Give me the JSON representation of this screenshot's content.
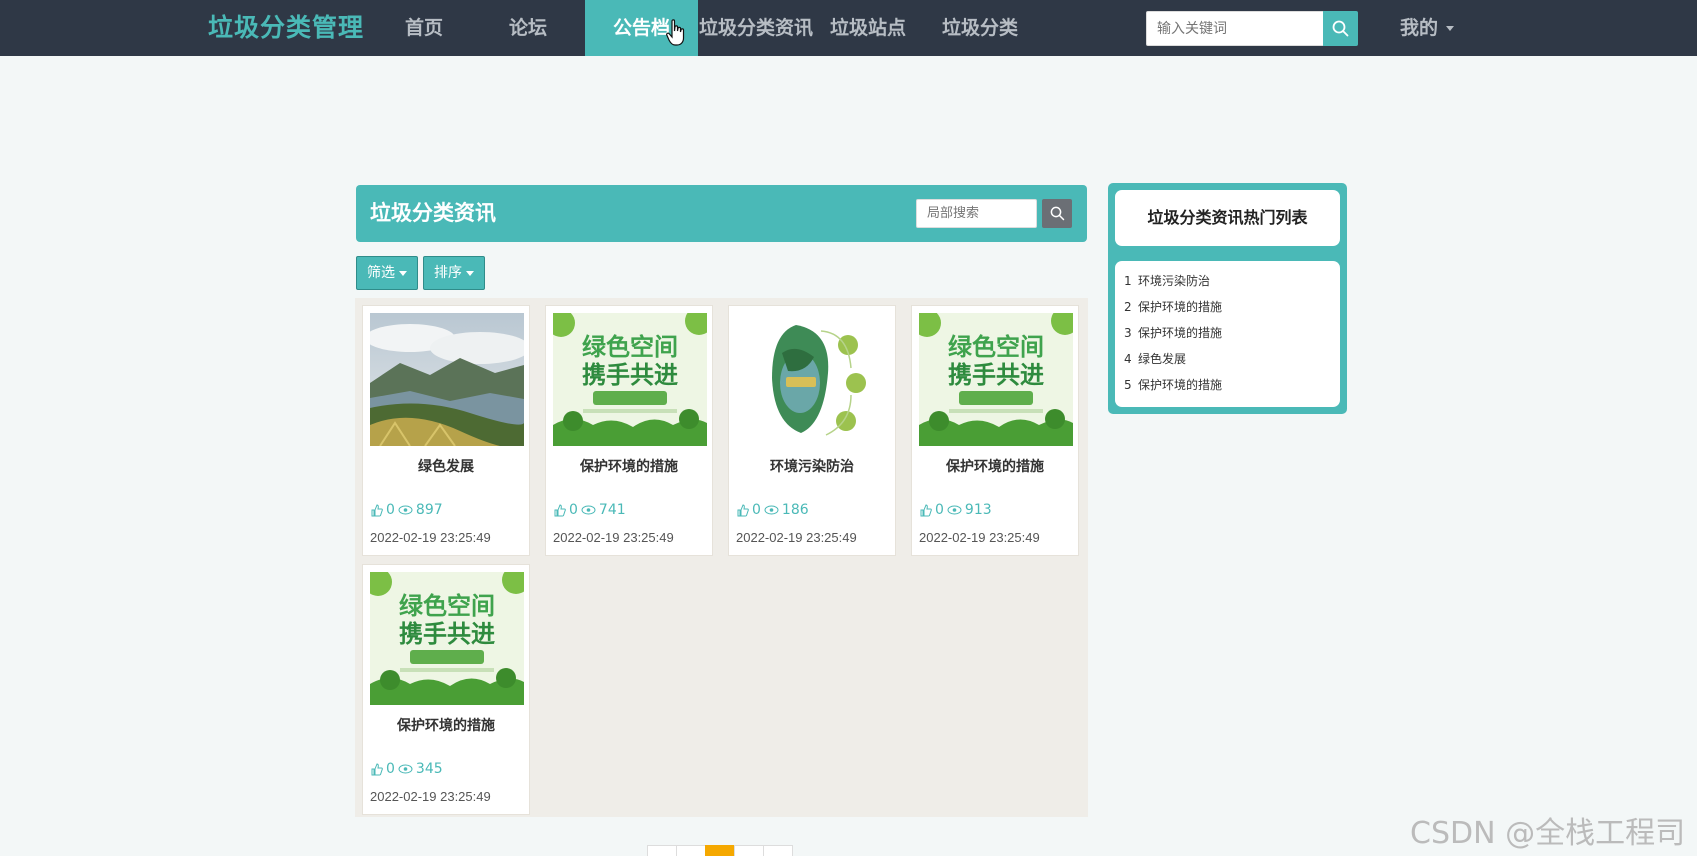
{
  "brand": "垃圾分类管理",
  "nav": {
    "items": [
      {
        "label": "首页",
        "active": false
      },
      {
        "label": "论坛",
        "active": false
      },
      {
        "label": "公告档",
        "active": true
      },
      {
        "label": "垃圾分类资讯",
        "active": false
      },
      {
        "label": "垃圾站点",
        "active": false
      },
      {
        "label": "垃圾分类",
        "active": false
      }
    ],
    "search_placeholder": "输入关键词",
    "user_menu": "我的"
  },
  "main": {
    "title": "垃圾分类资讯",
    "local_search_placeholder": "局部搜索",
    "filter_label": "筛选",
    "sort_label": "排序"
  },
  "cards": [
    {
      "title": "绿色发展",
      "likes": "0",
      "views": "897",
      "date": "2022-02-19 23:25:49",
      "image": "mountain-landscape"
    },
    {
      "title": "保护环境的措施",
      "likes": "0",
      "views": "741",
      "date": "2022-02-19 23:25:49",
      "image": "green-space-poster",
      "poster_line1": "绿色空间",
      "poster_line2": "携手共进"
    },
    {
      "title": "环境污染防治",
      "likes": "0",
      "views": "186",
      "date": "2022-02-19 23:25:49",
      "image": "earth-globe"
    },
    {
      "title": "保护环境的措施",
      "likes": "0",
      "views": "913",
      "date": "2022-02-19 23:25:49",
      "image": "green-space-poster",
      "poster_line1": "绿色空间",
      "poster_line2": "携手共进"
    },
    {
      "title": "保护环境的措施",
      "likes": "0",
      "views": "345",
      "date": "2022-02-19 23:25:49",
      "image": "green-space-poster",
      "poster_line1": "绿色空间",
      "poster_line2": "携手共进"
    }
  ],
  "hot_list": {
    "title": "垃圾分类资讯热门列表",
    "items": [
      {
        "num": "1",
        "label": "环境污染防治"
      },
      {
        "num": "2",
        "label": "保护环境的措施"
      },
      {
        "num": "3",
        "label": "保护环境的措施"
      },
      {
        "num": "4",
        "label": "绿色发展"
      },
      {
        "num": "5",
        "label": "保护环境的措施"
      }
    ]
  },
  "pagination": {
    "current_page": 3,
    "page_count": 5
  },
  "watermark": "CSDN @全栈工程司",
  "colors": {
    "accent": "#4ab9b7",
    "nav_bg": "#2f3846",
    "page_active": "#f5a800"
  }
}
